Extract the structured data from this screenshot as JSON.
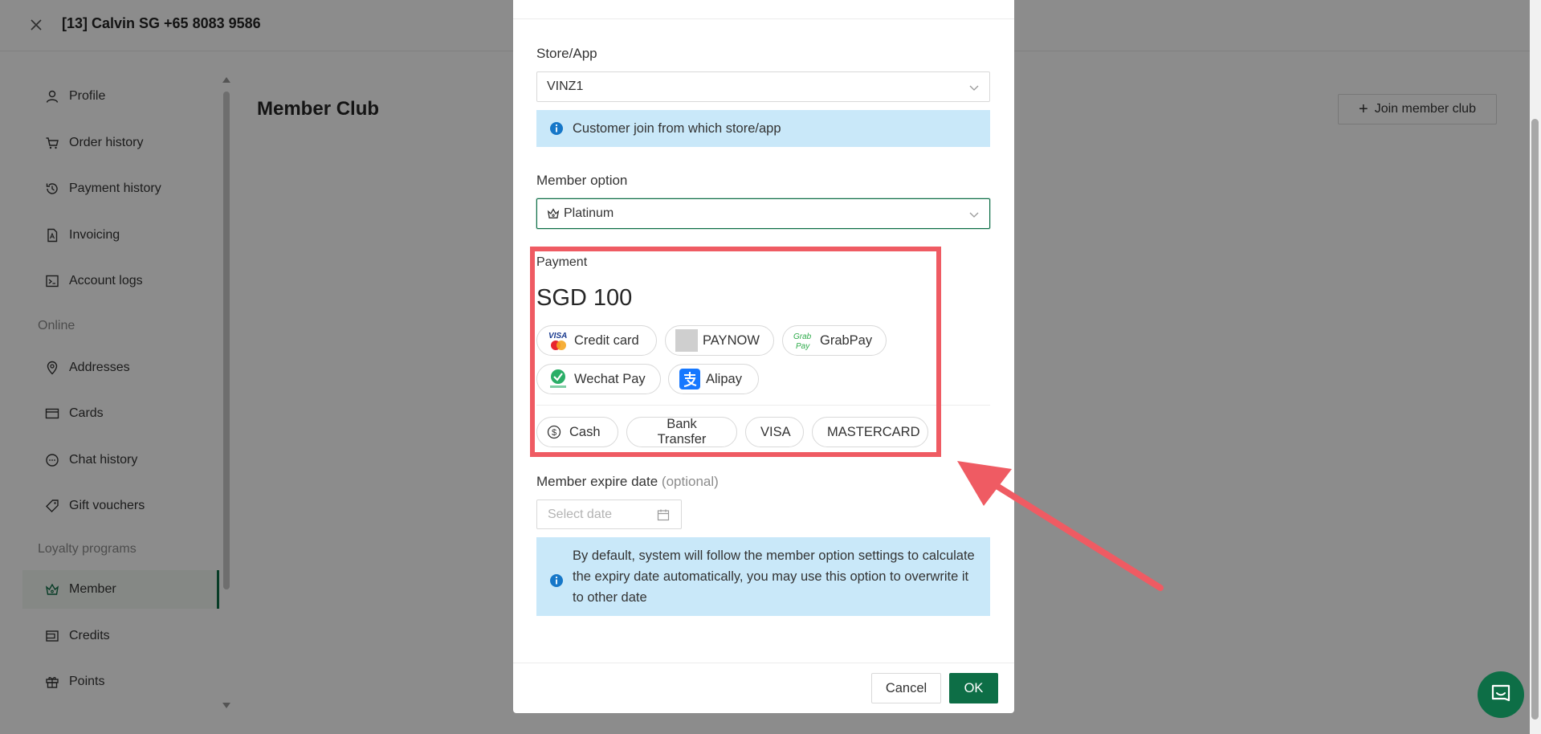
{
  "header": {
    "title": "[13] Calvin SG +65 8083 9586"
  },
  "sidebar": {
    "items": [
      {
        "label": "Profile",
        "icon": "user-icon"
      },
      {
        "label": "Order history",
        "icon": "cart-icon"
      },
      {
        "label": "Payment history",
        "icon": "history-icon"
      },
      {
        "label": "Invoicing",
        "icon": "file-pdf-icon"
      },
      {
        "label": "Account logs",
        "icon": "terminal-icon"
      }
    ],
    "section_online": "Online",
    "online_items": [
      {
        "label": "Addresses",
        "icon": "location-icon"
      },
      {
        "label": "Cards",
        "icon": "card-icon"
      },
      {
        "label": "Chat history",
        "icon": "chat-icon"
      },
      {
        "label": "Gift vouchers",
        "icon": "tag-icon"
      }
    ],
    "section_loyalty": "Loyalty programs",
    "loyalty_items": [
      {
        "label": "Member",
        "icon": "crown-icon",
        "active": true
      },
      {
        "label": "Credits",
        "icon": "wallet-icon"
      },
      {
        "label": "Points",
        "icon": "gift-icon"
      }
    ]
  },
  "main": {
    "title": "Member Club",
    "join_button": "Join member club"
  },
  "modal": {
    "store_label": "Store/App",
    "store_value": "VINZ1",
    "store_info": "Customer join from which store/app",
    "member_option_label": "Member option",
    "member_option_value": "Platinum",
    "payment_label": "Payment",
    "amount": "SGD 100",
    "payment_methods": [
      {
        "label": "Credit card",
        "icon": "visa-mastercard-icon"
      },
      {
        "label": "PAYNOW",
        "icon": "paynow-icon"
      },
      {
        "label": "GrabPay",
        "icon": "grabpay-icon"
      },
      {
        "label": "Wechat Pay",
        "icon": "wechat-pay-icon"
      },
      {
        "label": "Alipay",
        "icon": "alipay-icon"
      }
    ],
    "offline_methods": [
      {
        "label": "Cash",
        "icon": "dollar-icon"
      },
      {
        "label": "Bank Transfer"
      },
      {
        "label": "VISA"
      },
      {
        "label": "MASTERCARD"
      }
    ],
    "expire_label": "Member expire date",
    "expire_optional": "(optional)",
    "date_placeholder": "Select date",
    "expire_info": "By default, system will follow the member option settings to calculate the expiry date automatically, you may use this option to overwrite it to other date",
    "cancel_button": "Cancel",
    "ok_button": "OK"
  },
  "colors": {
    "brand_green": "#0d6e46",
    "info_bg": "#c9e8f9",
    "annotation_red": "#ef5b63"
  }
}
